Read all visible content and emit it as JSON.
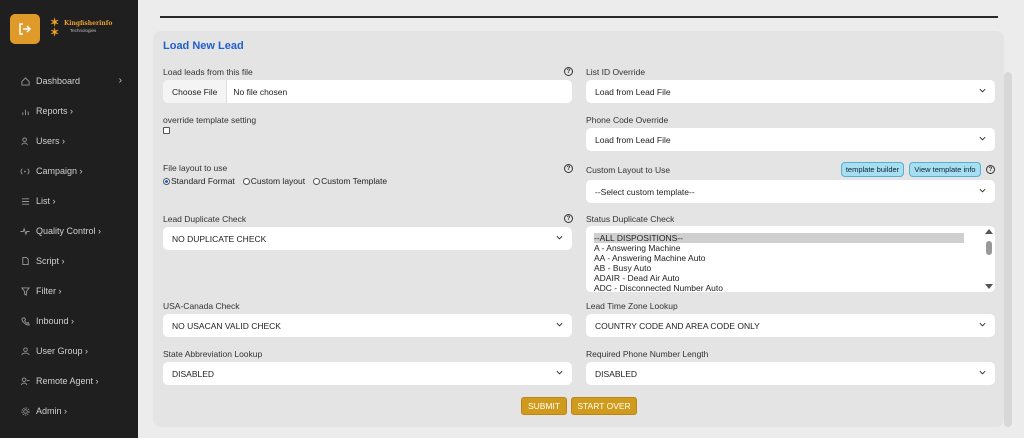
{
  "sidebar": {
    "logo": {
      "name": "Kingfisherinfo",
      "sub": "Technologies"
    },
    "items": [
      {
        "label": "Dashboard",
        "icon": "home-icon",
        "chevron": "›"
      },
      {
        "label": "Reports ›",
        "icon": "bar-chart-icon"
      },
      {
        "label": "Users ›",
        "icon": "users-icon"
      },
      {
        "label": "Campaign ›",
        "icon": "broadcast-icon"
      },
      {
        "label": "List ›",
        "icon": "list-icon"
      },
      {
        "label": "Quality Control ›",
        "icon": "activity-icon"
      },
      {
        "label": "Script ›",
        "icon": "document-icon"
      },
      {
        "label": "Filter ›",
        "icon": "filter-icon"
      },
      {
        "label": "Inbound ›",
        "icon": "phone-incoming-icon"
      },
      {
        "label": "User Group ›",
        "icon": "user-group-icon"
      },
      {
        "label": "Remote Agent ›",
        "icon": "remote-agent-icon"
      },
      {
        "label": "Admin ›",
        "icon": "gear-icon"
      }
    ]
  },
  "form": {
    "title": "Load New Lead",
    "load_file_label": "Load leads from this file",
    "choose_file": "Choose File",
    "no_file": "No file chosen",
    "list_id_label": "List ID Override",
    "list_id_value": "Load from Lead File",
    "override_label": "override template setting",
    "phone_code_label": "Phone Code Override",
    "phone_code_value": "Load from Lead File",
    "file_layout_label": "File layout to use",
    "layout_options": [
      "Standard Format",
      "Custom layout",
      "Custom Template"
    ],
    "custom_layout_label": "Custom Layout to Use",
    "template_builder": "template builder",
    "view_template_info": "View template info",
    "custom_template_value": "--Select custom template--",
    "dup_check_label": "Lead Duplicate Check",
    "dup_check_value": "NO DUPLICATE CHECK",
    "status_dup_label": "Status Duplicate Check",
    "status_options": [
      "--ALL DISPOSITIONS--",
      "A - Answering Machine",
      "AA - Answering Machine Auto",
      "AB - Busy Auto",
      "ADAIR - Dead Air Auto",
      "ADC - Disconnected Number Auto"
    ],
    "usa_canada_label": "USA-Canada Check",
    "usa_canada_value": "NO USACAN VALID CHECK",
    "time_zone_label": "Lead Time Zone Lookup",
    "time_zone_value": "COUNTRY CODE AND AREA CODE ONLY",
    "state_abbr_label": "State Abbreviation Lookup",
    "state_abbr_value": "DISABLED",
    "req_phone_label": "Required Phone Number Length",
    "req_phone_value": "DISABLED",
    "help_glyph": "?",
    "submit": "SUBMIT",
    "start_over": "START OVER"
  },
  "colors": {
    "sidebar_bg": "#1f1f1f",
    "accent": "#d09a1c",
    "title_blue": "#1f5fd0",
    "pill_bg": "#a6def2"
  }
}
